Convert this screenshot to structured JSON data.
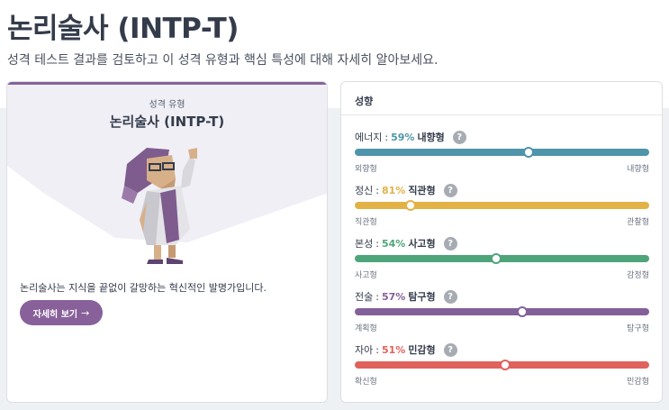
{
  "header": {
    "title": "논리술사 (INTP-T)",
    "subtitle": "성격 테스트 결과를 검토하고 이 성격 유형과 핵심 특성에 대해 자세히 알아보세요."
  },
  "type_card": {
    "label": "성격 유형",
    "name": "논리술사 (INTP-T)",
    "description": "논리술사는 지식을 끝없이 갈망하는 혁신적인 발명가입니다.",
    "button_label": "자세히 보기",
    "button_icon": "→",
    "accent_color": "#88619a"
  },
  "traits_panel": {
    "title": "성향",
    "help_icon": "?",
    "traits": [
      {
        "name": "에너지",
        "percent": "59%",
        "result": "내향형",
        "left": "외향형",
        "right": "내향형",
        "color": "#4e94aa",
        "position": 0.59
      },
      {
        "name": "정신",
        "percent": "81%",
        "result": "직관형",
        "left": "직관형",
        "right": "관찰형",
        "color": "#e3b247",
        "position": 0.19
      },
      {
        "name": "본성",
        "percent": "54%",
        "result": "사고형",
        "left": "사고형",
        "right": "감정형",
        "color": "#4fa57a",
        "position": 0.48
      },
      {
        "name": "전술",
        "percent": "57%",
        "result": "탐구형",
        "left": "계획형",
        "right": "탐구형",
        "color": "#84609a",
        "position": 0.57
      },
      {
        "name": "자아",
        "percent": "51%",
        "result": "민감형",
        "left": "확신형",
        "right": "민감형",
        "color": "#e0625c",
        "position": 0.51
      }
    ]
  }
}
